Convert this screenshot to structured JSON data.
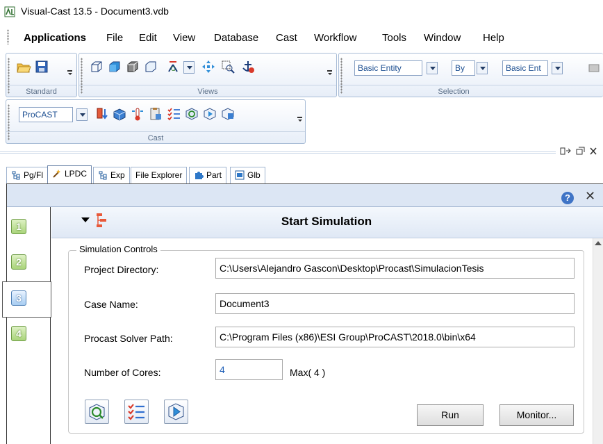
{
  "window": {
    "title": "Visual-Cast 13.5 - Document3.vdb"
  },
  "menu": [
    {
      "label": "Applications"
    },
    {
      "label": "File"
    },
    {
      "label": "Edit"
    },
    {
      "label": "View"
    },
    {
      "label": "Database"
    },
    {
      "label": "Cast"
    },
    {
      "label": "Workflow"
    },
    {
      "label": "Tools"
    },
    {
      "label": "Window"
    },
    {
      "label": "Help"
    }
  ],
  "toolbars": {
    "standard": {
      "label": "Standard"
    },
    "views": {
      "label": "Views"
    },
    "selection": {
      "label": "Selection",
      "entity_combo": "Basic Entity",
      "by_combo": "By",
      "entity_combo2": "Basic Ent"
    },
    "cast": {
      "label": "Cast",
      "solver_combo": "ProCAST"
    }
  },
  "tabs": [
    {
      "label": "Pg/Fl",
      "icon": "tree-icon"
    },
    {
      "label": "LPDC",
      "icon": "wizard-icon"
    },
    {
      "label": "Exp",
      "icon": "tree-icon"
    },
    {
      "label": "File Explorer",
      "icon": ""
    },
    {
      "label": "Part",
      "icon": "puzzle-icon"
    },
    {
      "label": "Glb",
      "icon": "globe-icon"
    }
  ],
  "steps": [
    {
      "label": "1"
    },
    {
      "label": "2"
    },
    {
      "label": "3"
    },
    {
      "label": "4"
    }
  ],
  "section": {
    "title": "Start Simulation",
    "group_title": "Simulation Controls",
    "fields": {
      "project_directory": {
        "label": "Project Directory:",
        "value": "C:\\Users\\Alejandro Gascon\\Desktop\\Procast\\SimulacionTesis"
      },
      "case_name": {
        "label": "Case Name:",
        "value": "Document3"
      },
      "solver_path": {
        "label": "Procast Solver Path:",
        "value": "C:\\Program Files (x86)\\ESI Group\\ProCAST\\2018.0\\bin\\x64"
      },
      "cores": {
        "label": "Number of Cores:",
        "value": "4",
        "max": "Max( 4 )"
      }
    },
    "buttons": {
      "run": "Run",
      "monitor": "Monitor..."
    }
  },
  "colors": {
    "accent": "#3f74c6",
    "step_green": "#a9d47a",
    "step_blue": "#a8cdf2",
    "panel_header": "#dce6f4"
  }
}
